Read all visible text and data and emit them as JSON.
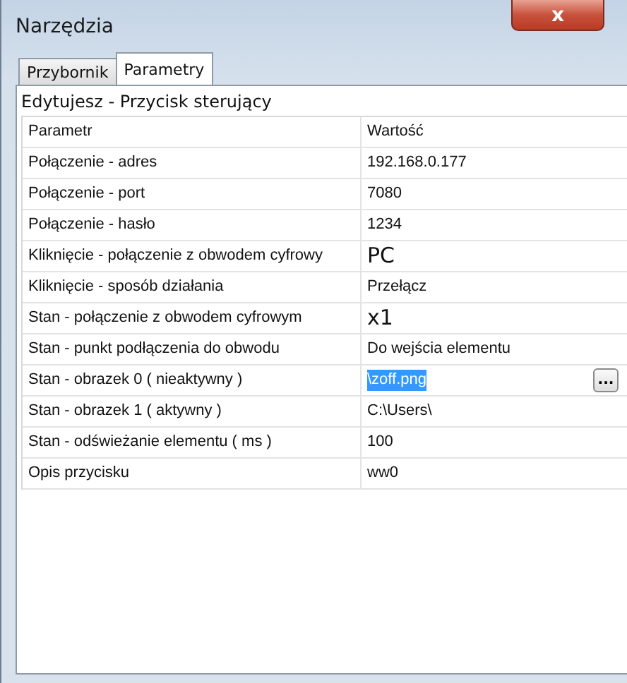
{
  "window": {
    "title": "Narzędzia",
    "close": "x"
  },
  "tabs": [
    {
      "label": "Przybornik",
      "selected": false
    },
    {
      "label": "Parametry",
      "selected": true
    }
  ],
  "editing_caption": "Edytujesz - Przycisk sterujący",
  "grid": {
    "columns": [
      "Parametr",
      "Wartość"
    ],
    "rows": [
      {
        "kind": "plain",
        "param": "Połączenie - adres",
        "value": "192.168.0.177"
      },
      {
        "kind": "plain",
        "param": "Połączenie - port",
        "value": "7080"
      },
      {
        "kind": "plain",
        "param": "Połączenie - hasło",
        "value": "1234"
      },
      {
        "kind": "large",
        "param": "Kliknięcie - połączenie z obwodem cyfrowy",
        "value": "PC"
      },
      {
        "kind": "plain",
        "param": "Kliknięcie - sposób działania",
        "value": "Przełącz"
      },
      {
        "kind": "large",
        "param": "Stan - połączenie z obwodem cyfrowym",
        "value": "x1"
      },
      {
        "kind": "plain",
        "param": "Stan - punkt podłączenia do obwodu",
        "value": "Do wejścia elementu"
      },
      {
        "kind": "file",
        "param": "Stan - obrazek 0 ( nieaktywny )",
        "value": "\\zoff.png",
        "selected": true,
        "browse": "..."
      },
      {
        "kind": "plain",
        "param": "Stan - obrazek 1 ( aktywny )",
        "value": "C:\\Users\\"
      },
      {
        "kind": "plain",
        "param": "Stan - odświeżanie elementu ( ms )",
        "value": "100"
      },
      {
        "kind": "plain",
        "param": "Opis przycisku",
        "value": "ww0"
      }
    ]
  }
}
